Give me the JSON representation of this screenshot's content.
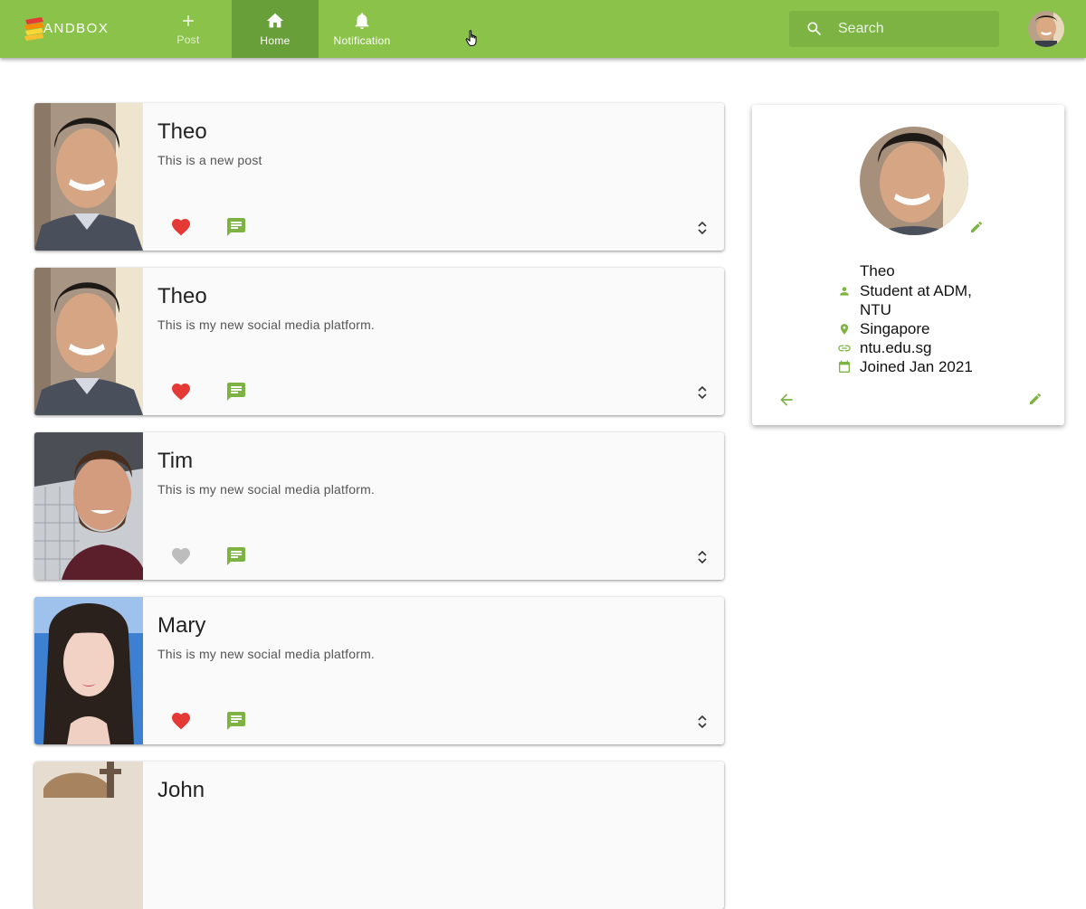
{
  "app": {
    "brand": "ANDBOX",
    "accent": "#8bc34a",
    "accent_dark": "#689f38"
  },
  "nav": [
    {
      "label": "Post",
      "icon": "plus-icon",
      "active": false
    },
    {
      "label": "Home",
      "icon": "home-icon",
      "active": true
    },
    {
      "label": "Notification",
      "icon": "bell-icon",
      "active": false
    }
  ],
  "search": {
    "placeholder": "Search",
    "value": ""
  },
  "posts": [
    {
      "author": "Theo",
      "body": "This is a new post",
      "liked": true
    },
    {
      "author": "Theo",
      "body": "This is my new social media platform.",
      "liked": true
    },
    {
      "author": "Tim",
      "body": "This is my new social media platform.",
      "liked": false
    },
    {
      "author": "Mary",
      "body": "This is my new social media platform.",
      "liked": true
    },
    {
      "author": "John",
      "body": "",
      "liked": false
    }
  ],
  "profile": {
    "name": "Theo",
    "bio": "Student at ADM, NTU",
    "location": "Singapore",
    "website": "ntu.edu.sg",
    "joined": "Joined Jan 2021"
  },
  "colors": {
    "like_active": "#e53935",
    "like_inactive": "#bdbdbd",
    "icon_green": "#7cb342"
  }
}
